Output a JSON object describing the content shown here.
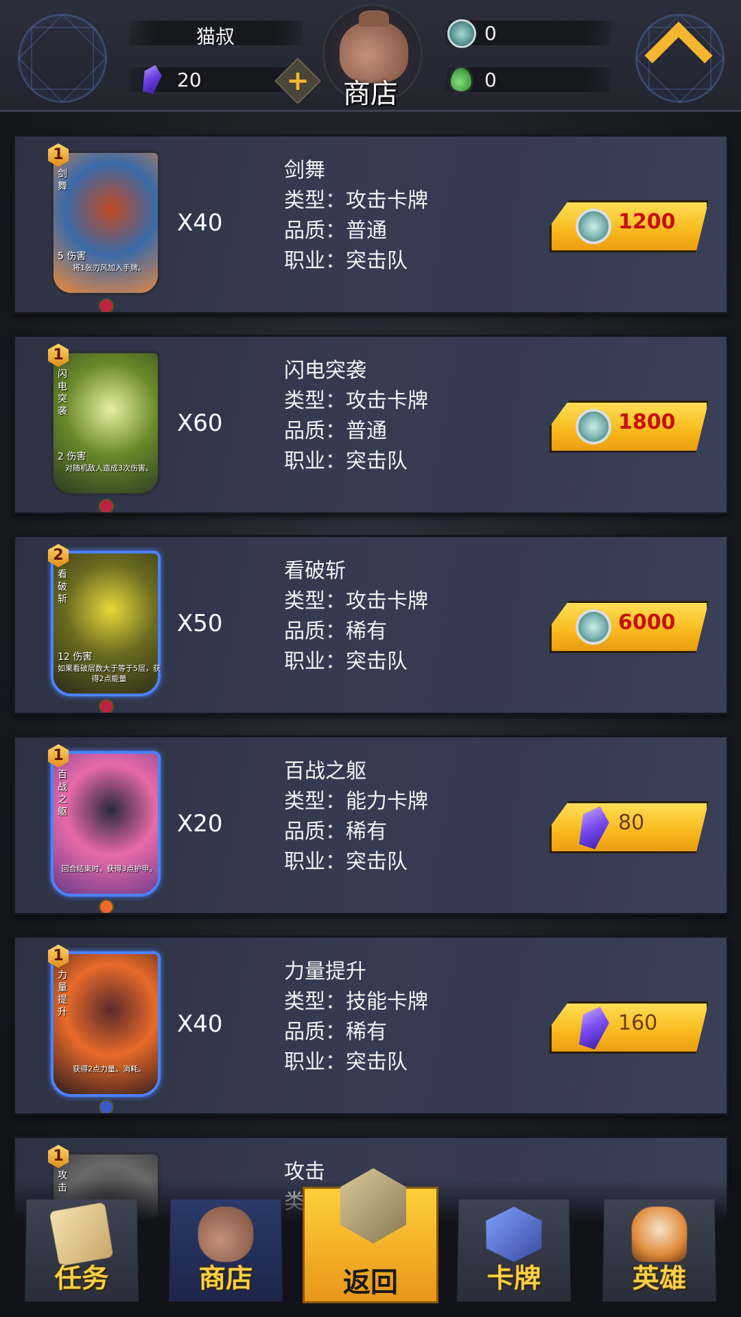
{
  "header": {
    "player_name": "猫叔",
    "crystals": "20",
    "plus": "+",
    "shop_title": "商店",
    "coins": "0",
    "green_currency": "0"
  },
  "items": [
    {
      "card_cost": "1",
      "card_name": "剑舞",
      "card_damage": "5 伤害",
      "card_desc": "将1张刃风加入手牌。",
      "quantity": "X40",
      "name": "剑舞",
      "type": "类型：攻击卡牌",
      "quality": "品质：普通",
      "class": "职业：突击队",
      "price": "1200",
      "currency": "coin",
      "rarity": "common",
      "art_colors": [
        "#c24a22",
        "#3a6aa8",
        "#f08a3a"
      ]
    },
    {
      "card_cost": "1",
      "card_name": "闪电突袭",
      "card_damage": "2 伤害",
      "card_desc": "对随机敌人造成3次伤害。",
      "quantity": "X60",
      "name": "闪电突袭",
      "type": "类型：攻击卡牌",
      "quality": "品质：普通",
      "class": "职业：突击队",
      "price": "1800",
      "currency": "coin",
      "rarity": "common",
      "art_colors": [
        "#e8f0a0",
        "#6a8a2a",
        "#2a3a20"
      ]
    },
    {
      "card_cost": "2",
      "card_name": "看破斩",
      "card_damage": "12 伤害",
      "card_desc": "如果看破层数大于等于5层，获得2点能量",
      "quantity": "X50",
      "name": "看破斩",
      "type": "类型：攻击卡牌",
      "quality": "品质：稀有",
      "class": "职业：突击队",
      "price": "6000",
      "currency": "coin",
      "rarity": "rare",
      "art_colors": [
        "#e8d83a",
        "#6a6a20",
        "#2a2a18"
      ]
    },
    {
      "card_cost": "1",
      "card_name": "百战之躯",
      "card_damage": "",
      "card_desc": "回合结束时，获得3点护甲。",
      "quantity": "X20",
      "name": "百战之躯",
      "type": "类型：能力卡牌",
      "quality": "品质：稀有",
      "class": "职业：突击队",
      "price": "80",
      "currency": "gem",
      "rarity": "rare",
      "art_colors": [
        "#2a2a3a",
        "#e86aa8",
        "#6a3a8a"
      ]
    },
    {
      "card_cost": "1",
      "card_name": "力量提升",
      "card_damage": "",
      "card_desc": "获得2点力量。消耗。",
      "quantity": "X40",
      "name": "力量提升",
      "type": "类型：技能卡牌",
      "quality": "品质：稀有",
      "class": "职业：突击队",
      "price": "160",
      "currency": "gem",
      "rarity": "rare",
      "art_colors": [
        "#5a2a2a",
        "#e86a2a",
        "#2a1a1a"
      ]
    },
    {
      "card_cost": "1",
      "card_name": "攻击",
      "quantity": "",
      "name": "攻击",
      "type": "类"
    }
  ],
  "nav": {
    "quests": "任务",
    "shop": "商店",
    "back": "返回",
    "cards": "卡牌",
    "heroes": "英雄"
  }
}
